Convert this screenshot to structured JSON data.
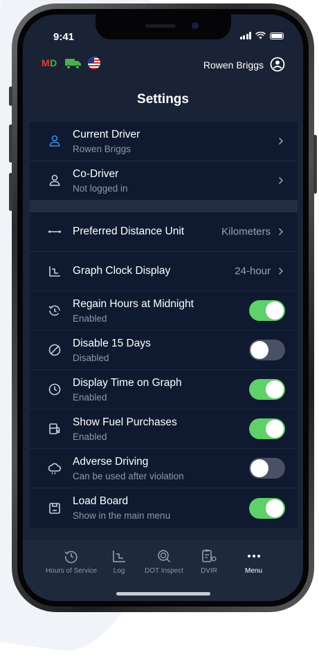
{
  "status": {
    "time": "9:41"
  },
  "header": {
    "md_badge_m": "M",
    "md_badge_d": "D",
    "user_name": "Rowen Briggs",
    "title": "Settings"
  },
  "drivers": [
    {
      "label": "Current Driver",
      "sub": "Rowen Briggs",
      "icon": "user-icon",
      "accent": "#3a8be8"
    },
    {
      "label": "Co-Driver",
      "sub": "Not logged in",
      "icon": "user-outline-icon"
    }
  ],
  "preferences": [
    {
      "label": "Preferred Distance Unit",
      "value": "Kilometers",
      "icon": "distance-icon"
    },
    {
      "label": "Graph Clock Display",
      "value": "24-hour",
      "icon": "graph-icon"
    }
  ],
  "toggles": [
    {
      "label": "Regain Hours at Midnight",
      "sub": "Enabled",
      "on": true,
      "icon": "regain-hours-icon"
    },
    {
      "label": "Disable 15 Days",
      "sub": "Disabled",
      "on": false,
      "icon": "disable-icon"
    },
    {
      "label": "Display Time on Graph",
      "sub": "Enabled",
      "on": true,
      "icon": "clock-icon"
    },
    {
      "label": "Show Fuel Purchases",
      "sub": "Enabled",
      "on": true,
      "icon": "fuel-icon"
    },
    {
      "label": "Adverse Driving",
      "sub": "Can be used after violation",
      "on": false,
      "icon": "adverse-weather-icon"
    },
    {
      "label": "Load Board",
      "sub": "Show in the main menu",
      "on": true,
      "icon": "load-board-icon"
    }
  ],
  "tabs": [
    {
      "label": "Hours of Service",
      "icon": "hours-icon"
    },
    {
      "label": "Log",
      "icon": "log-icon"
    },
    {
      "label": "DOT Inspect",
      "icon": "dot-inspect-icon"
    },
    {
      "label": "DVIR",
      "icon": "dvir-icon"
    },
    {
      "label": "Menu",
      "icon": "menu-dots-icon",
      "active": true
    }
  ],
  "colors": {
    "background": "#1a2335",
    "list_bg": "#0f1a30",
    "toggle_on": "#5fd06a",
    "toggle_off": "#4a5164",
    "md_red": "#e53935",
    "md_green": "#4caf50"
  }
}
